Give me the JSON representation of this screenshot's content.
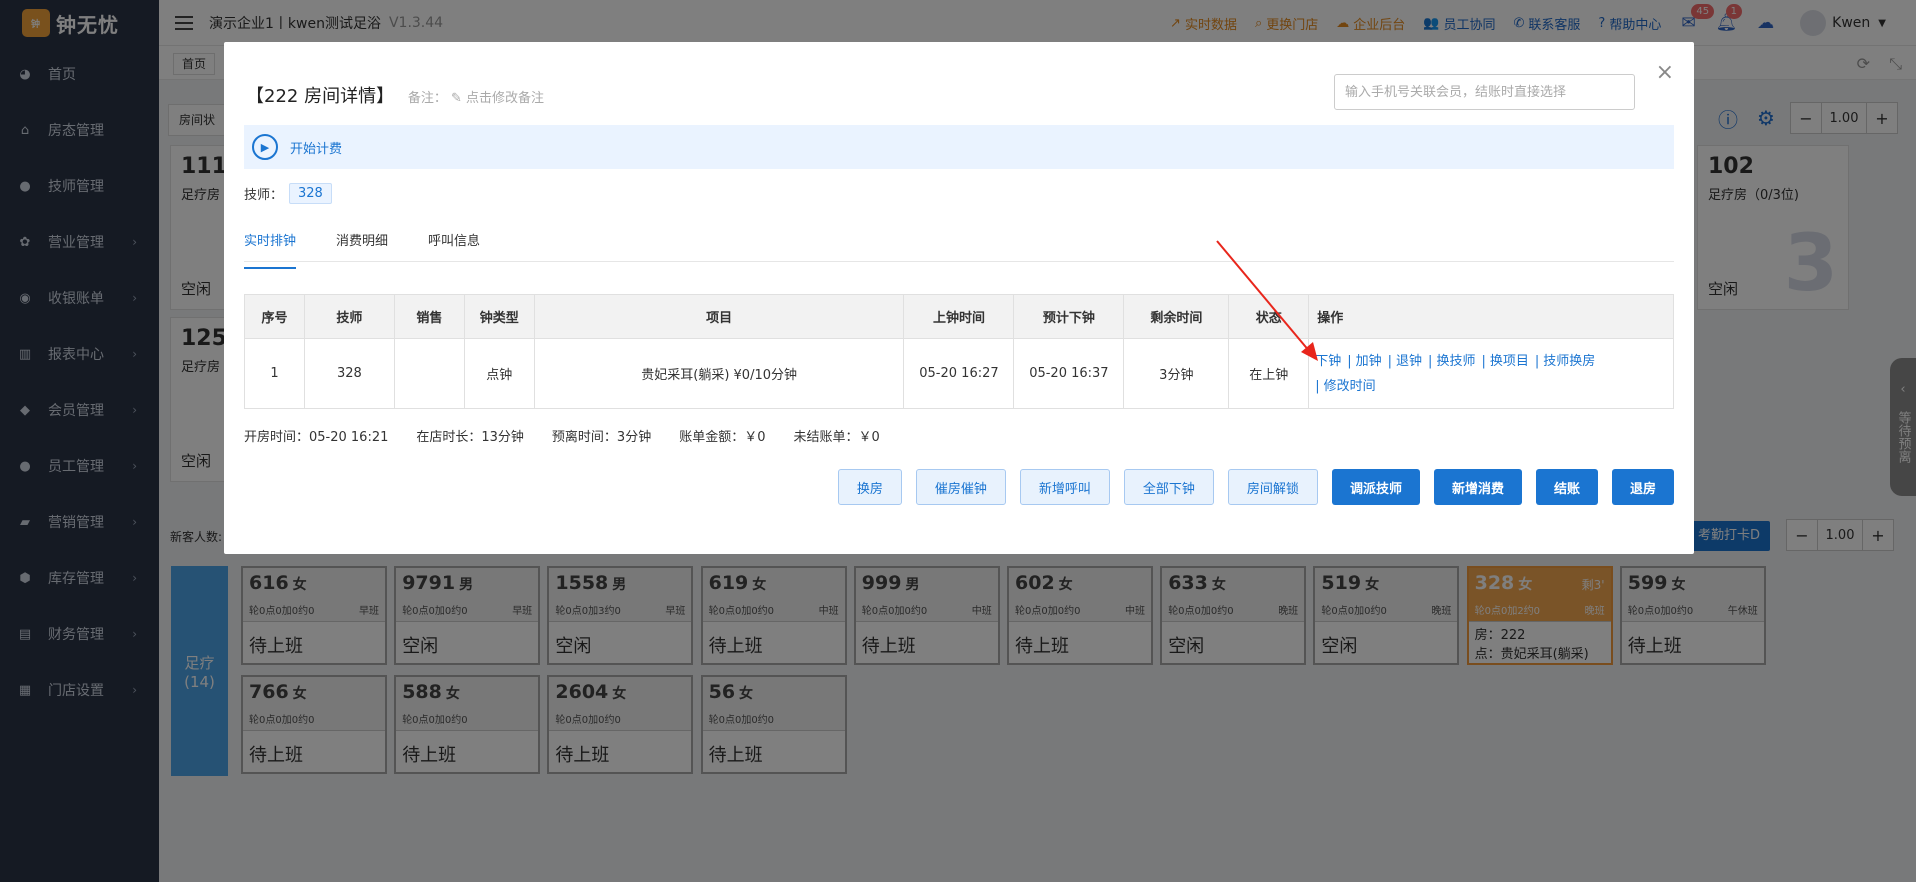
{
  "app": {
    "logo": "钟无忧",
    "title": "演示企业1丨kwen测试足浴",
    "version": "V1.3.44",
    "home_tab": "首页"
  },
  "sidebar": {
    "items": [
      {
        "label": "首页",
        "icon": "palette-icon"
      },
      {
        "label": "房态管理",
        "icon": "home-icon"
      },
      {
        "label": "技师管理",
        "icon": "user-icon"
      },
      {
        "label": "营业管理",
        "icon": "settings-icon"
      },
      {
        "label": "收银账单",
        "icon": "cash-icon"
      },
      {
        "label": "报表中心",
        "icon": "chart-icon"
      },
      {
        "label": "会员管理",
        "icon": "diamond-icon"
      },
      {
        "label": "员工管理",
        "icon": "user-icon"
      },
      {
        "label": "营销管理",
        "icon": "briefcase-icon"
      },
      {
        "label": "库存管理",
        "icon": "box-icon"
      },
      {
        "label": "财务管理",
        "icon": "wallet-icon"
      },
      {
        "label": "门店设置",
        "icon": "grid-icon"
      }
    ]
  },
  "header": {
    "links": [
      {
        "label": "实时数据",
        "icon": "trend-icon",
        "color": "#e58a1f"
      },
      {
        "label": "更换门店",
        "icon": "search-icon",
        "color": "#e58a1f"
      },
      {
        "label": "企业后台",
        "icon": "cloud-icon",
        "color": "#e58a1f"
      },
      {
        "label": "员工协同",
        "icon": "users-icon",
        "color": "#1f68c9"
      },
      {
        "label": "联系客服",
        "icon": "phone-icon",
        "color": "#1f68c9"
      },
      {
        "label": "帮助中心",
        "icon": "help-icon",
        "color": "#1f68c9"
      }
    ],
    "mail_badge": "45",
    "bell_badge": "1",
    "user": "Kwen"
  },
  "background": {
    "state_filter": "房间状",
    "zoom": "1.00",
    "zoom2": "1.00",
    "new_guest": "新客人数:",
    "attendance": "考勤打卡D",
    "rooms": [
      {
        "num": "111",
        "type": "足疗房",
        "status": "空闲"
      },
      {
        "num": "125",
        "type": "足疗房",
        "status": "空闲"
      },
      {
        "num": "102",
        "type": "足疗房（0/3位)",
        "status": "空闲",
        "big": "3"
      }
    ],
    "group_label": "足疗",
    "group_count": "(14)",
    "right_pull": "等待预离",
    "techs": [
      {
        "num": "616",
        "sex": "女",
        "sub": "轮0点0加0约0",
        "shift": "早班",
        "status": "待上班"
      },
      {
        "num": "9791",
        "sex": "男",
        "sub": "轮0点0加0约0",
        "shift": "早班",
        "status": "空闲"
      },
      {
        "num": "1558",
        "sex": "男",
        "sub": "轮0点0加3约0",
        "shift": "早班",
        "status": "空闲"
      },
      {
        "num": "619",
        "sex": "女",
        "sub": "轮0点0加0约0",
        "shift": "中班",
        "status": "待上班"
      },
      {
        "num": "999",
        "sex": "男",
        "sub": "轮0点0加0约0",
        "shift": "中班",
        "status": "待上班"
      },
      {
        "num": "602",
        "sex": "女",
        "sub": "轮0点0加0约0",
        "shift": "中班",
        "status": "待上班"
      },
      {
        "num": "633",
        "sex": "女",
        "sub": "轮0点0加0约0",
        "shift": "晚班",
        "status": "空闲"
      },
      {
        "num": "519",
        "sex": "女",
        "sub": "轮0点0加0约0",
        "shift": "晚班",
        "status": "空闲"
      },
      {
        "num": "328",
        "sex": "女",
        "sub": "轮0点0加2约0",
        "shift": "晚班",
        "room": "房：222",
        "item": "点：贵妃采耳(躺采)",
        "remain": "剩3'"
      },
      {
        "num": "599",
        "sex": "女",
        "sub": "轮0点0加0约0",
        "shift": "午休班",
        "status": "待上班"
      },
      {
        "num": "766",
        "sex": "女",
        "sub": "轮0点0加0约0",
        "shift": "",
        "status": "待上班"
      },
      {
        "num": "588",
        "sex": "女",
        "sub": "轮0点0加0约0",
        "shift": "",
        "status": "待上班"
      },
      {
        "num": "2604",
        "sex": "女",
        "sub": "轮0点0加0约0",
        "shift": "",
        "status": "待上班"
      },
      {
        "num": "56",
        "sex": "女",
        "sub": "轮0点0加0约0",
        "shift": "",
        "status": "待上班"
      }
    ]
  },
  "modal": {
    "title": "【222 房间详情】",
    "note_label": "备注：",
    "note_action": "点击修改备注",
    "member_placeholder": "输入手机号关联会员，结账时直接选择",
    "start": "开始计费",
    "tech_label": "技师：",
    "tech_value": "328",
    "tabs": [
      "实时排钟",
      "消费明细",
      "呼叫信息"
    ],
    "table": {
      "headers": [
        "序号",
        "技师",
        "销售",
        "钟类型",
        "项目",
        "上钟时间",
        "预计下钟",
        "剩余时间",
        "状态",
        "操作"
      ],
      "rows": [
        {
          "seq": "1",
          "tech": "328",
          "sales": "",
          "type": "点钟",
          "item": "贵妃采耳(躺采) ¥0/10分钟",
          "start": "05-20 16:27",
          "end": "05-20 16:37",
          "remain": "3分钟",
          "status": "在上钟"
        }
      ],
      "ops": [
        "下钟",
        "加钟",
        "退钟",
        "换技师",
        "换项目",
        "技师换房",
        "修改时间"
      ]
    },
    "summary": {
      "open_time": "开房时间：05-20 16:21",
      "stay": "在店时长：13分钟",
      "leave": "预离时间：3分钟",
      "amount": "账单金额：￥0",
      "unpaid": "未结账单：￥0"
    },
    "buttons": {
      "light": [
        "换房",
        "催房催钟",
        "新增呼叫",
        "全部下钟",
        "房间解锁"
      ],
      "primary": [
        "调派技师",
        "新增消费",
        "结账",
        "退房"
      ]
    },
    "arrow_color": "#e8261c"
  }
}
